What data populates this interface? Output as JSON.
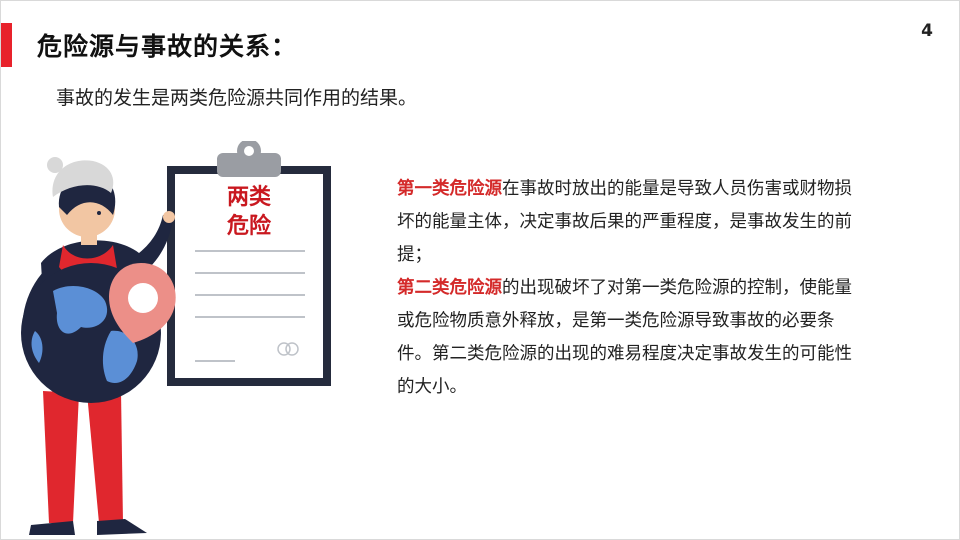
{
  "slide": {
    "title": "危险源与事故的关系：",
    "page_number": "4",
    "subtitle": "事故的发生是两类危险源共同作用的结果。"
  },
  "illustration": {
    "clipboard_label_line1": "两类",
    "clipboard_label_line2": "危险",
    "colors": {
      "red": "#e0272e",
      "dark": "#1f2640",
      "pin": "#ec8f88",
      "globe_land": "#5b8fd6",
      "board_frame": "#252b3d"
    }
  },
  "content": {
    "para1": {
      "highlight": "第一类危险源",
      "text": "在事故时放出的能量是导致人员伤害或财物损坏的能量主体，决定事故后果的严重程度，是事故发生的前提；"
    },
    "para2": {
      "highlight": "第二类危险源",
      "text": "的出现破坏了对第一类危险源的控制，使能量或危险物质意外释放，是第一类危险源导致事故的必要条件。第二类危险源的出现的难易程度决定事故发生的可能性的大小。"
    }
  },
  "colors": {
    "accent": "#e8222b",
    "highlight": "#d42a2a"
  }
}
